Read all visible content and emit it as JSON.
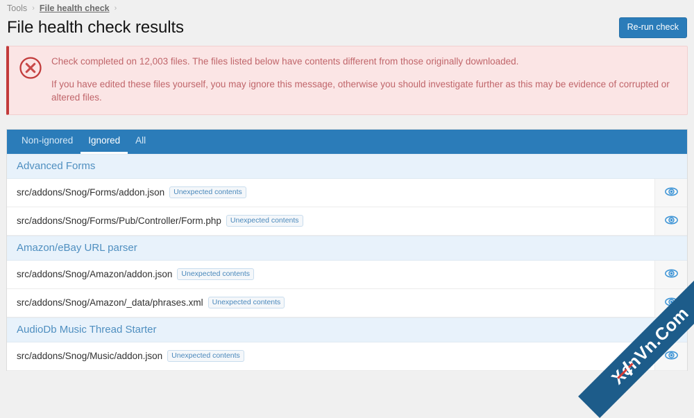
{
  "breadcrumb": {
    "items": [
      {
        "label": "Tools",
        "current": false
      },
      {
        "label": "File health check",
        "current": true
      }
    ],
    "separator": "›"
  },
  "header": {
    "title": "File health check results",
    "rerun_button": "Re-run check"
  },
  "alert": {
    "type": "error",
    "icon": "error-circle-x-icon",
    "line1": "Check completed on 12,003 files. The files listed below have contents different from those originally downloaded.",
    "line2": "If you have edited these files yourself, you may ignore this message, otherwise you should investigate further as this may be evidence of corrupted or altered files.",
    "files_checked": "12,003",
    "colors": {
      "background": "#fbe5e5",
      "border": "#f2cfcf",
      "accent": "#c23b3b",
      "text": "#c0656a"
    }
  },
  "tabs": [
    {
      "label": "Non-ignored",
      "active": false
    },
    {
      "label": "Ignored",
      "active": true
    },
    {
      "label": "All",
      "active": false
    }
  ],
  "colors": {
    "tab_bar": "#2b7cb9",
    "accent": "#2b7cb9",
    "section_header_bg": "#e8f2fb",
    "section_header_text": "#4f8fc0",
    "badge_text": "#4a88bb",
    "page_bg": "#f0f0f0"
  },
  "sections": [
    {
      "title": "Advanced Forms",
      "rows": [
        {
          "path": "src/addons/Snog/Forms/addon.json",
          "badge": "Unexpected contents",
          "action_icon": "eye-icon"
        },
        {
          "path": "src/addons/Snog/Forms/Pub/Controller/Form.php",
          "badge": "Unexpected contents",
          "action_icon": "eye-icon"
        }
      ]
    },
    {
      "title": "Amazon/eBay URL parser",
      "rows": [
        {
          "path": "src/addons/Snog/Amazon/addon.json",
          "badge": "Unexpected contents",
          "action_icon": "eye-icon"
        },
        {
          "path": "src/addons/Snog/Amazon/_data/phrases.xml",
          "badge": "Unexpected contents",
          "action_icon": "eye-icon"
        }
      ]
    },
    {
      "title": "AudioDb Music Thread Starter",
      "rows": [
        {
          "path": "src/addons/Snog/Music/addon.json",
          "badge": "Unexpected contents",
          "action_icon": "eye-icon"
        }
      ]
    }
  ],
  "watermark": {
    "text": "XenVn.Com"
  }
}
